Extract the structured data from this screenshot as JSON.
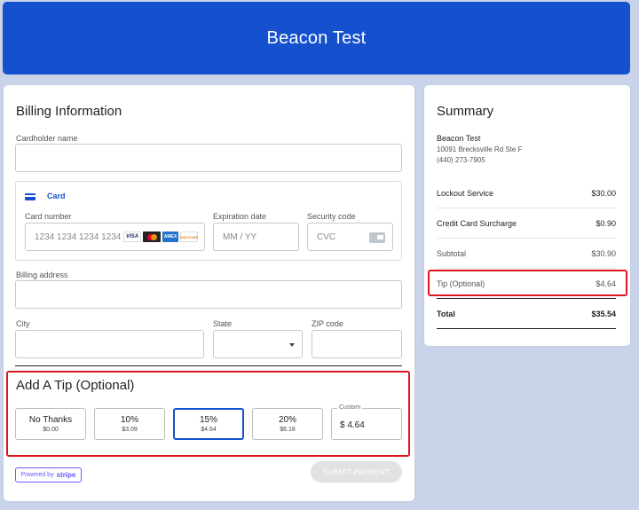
{
  "header": {
    "title": "Beacon Test"
  },
  "billing": {
    "title": "Billing Information",
    "cardholder_label": "Cardholder name",
    "card_tab": "Card",
    "card_number_label": "Card number",
    "card_number_placeholder": "1234 1234 1234 1234",
    "card_brands": {
      "visa": "VISA",
      "amex": "AMEX",
      "discover": "DISCOVER"
    },
    "expiration_label": "Expiration date",
    "expiration_placeholder": "MM / YY",
    "security_label": "Security code",
    "security_placeholder": "CVC",
    "address_label": "Billing address",
    "city_label": "City",
    "state_label": "State",
    "zip_label": "ZIP code"
  },
  "tip": {
    "title": "Add A Tip (Optional)",
    "options": [
      {
        "label": "No Thanks",
        "amount": "$0.00"
      },
      {
        "label": "10%",
        "amount": "$3.09"
      },
      {
        "label": "15%",
        "amount": "$4.64"
      },
      {
        "label": "20%",
        "amount": "$6.18"
      }
    ],
    "selected_index": 2,
    "custom_label": "Custom",
    "custom_value": "$ 4.64"
  },
  "footer": {
    "powered_by": "Powered by",
    "stripe": "stripe",
    "submit_label": "SUBMIT PAYMENT"
  },
  "summary": {
    "title": "Summary",
    "business_name": "Beacon Test",
    "address": "10091 Brecksville Rd Ste F",
    "phone": "(440) 273-7905",
    "items": [
      {
        "label": "Lockout Service",
        "value": "$30.00"
      },
      {
        "label": "Credit Card Surcharge",
        "value": "$0.90"
      }
    ],
    "subtotal_label": "Subtotal",
    "subtotal_value": "$30.90",
    "tip_label": "Tip (Optional)",
    "tip_value": "$4.64",
    "total_label": "Total",
    "total_value": "$35.54"
  },
  "colors": {
    "brand_blue": "#1550cf",
    "highlight_red": "#e0141e",
    "stripe_purple": "#635bff"
  }
}
